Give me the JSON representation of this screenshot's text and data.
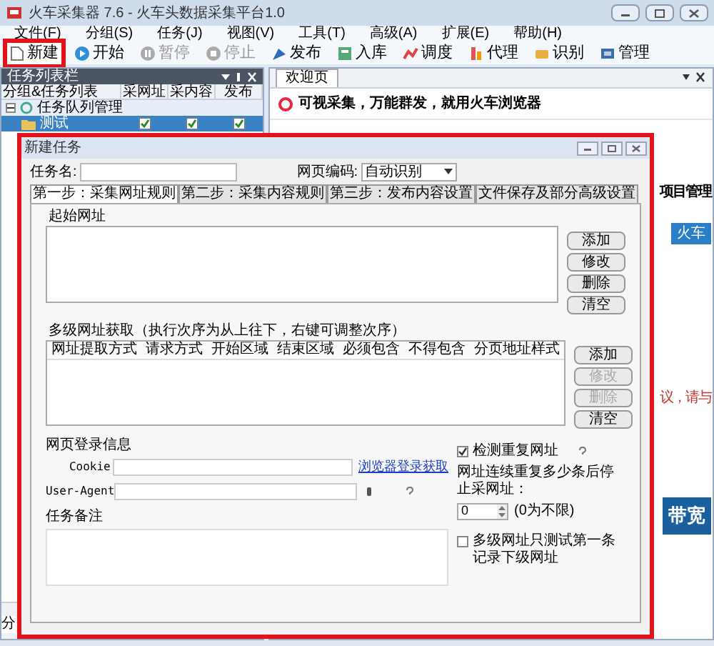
{
  "window": {
    "title": "火车采集器 7.6 - 火车头数据采集平台1.0"
  },
  "menu": [
    "文件(F)",
    "分组(S)",
    "任务(J)",
    "视图(V)",
    "工具(T)",
    "高级(A)",
    "扩展(E)",
    "帮助(H)"
  ],
  "toolbar": [
    {
      "label": "新建",
      "disabled": false,
      "highlighted": true
    },
    {
      "label": "开始",
      "disabled": false,
      "highlighted": false
    },
    {
      "label": "暂停",
      "disabled": true,
      "highlighted": false
    },
    {
      "label": "停止",
      "disabled": true,
      "highlighted": false
    },
    {
      "label": "发布",
      "disabled": false,
      "highlighted": false
    },
    {
      "label": "入库",
      "disabled": false,
      "highlighted": false
    },
    {
      "label": "调度",
      "disabled": false,
      "highlighted": false
    },
    {
      "label": "代理",
      "disabled": false,
      "highlighted": false
    },
    {
      "label": "识别",
      "disabled": false,
      "highlighted": false
    },
    {
      "label": "管理",
      "disabled": false,
      "highlighted": false
    }
  ],
  "task_panel": {
    "title": "任务列表栏",
    "columns": [
      "分组&任务列表",
      "采网址",
      "采内容",
      "发布"
    ],
    "groups": [
      {
        "label": "任务队列管理",
        "expanded": true,
        "children": [
          {
            "label": "测试",
            "selected": true,
            "collect_urls": true,
            "collect_content": true,
            "publish": true
          }
        ]
      }
    ],
    "bottom_tab": "分"
  },
  "welcome": {
    "tab": "欢迎页",
    "slogan": "可视采集，万能群发，就用火车浏览器",
    "snippets": [
      {
        "kind": "heading",
        "text": "项目管理"
      },
      {
        "kind": "badge",
        "text": "火车"
      },
      {
        "kind": "note",
        "text": "议，请与"
      },
      {
        "kind": "banner",
        "text": "带宽"
      }
    ]
  },
  "dialog": {
    "title": "新建任务",
    "task_name_label": "任务名:",
    "encoding": {
      "label": "网页编码:",
      "value": "自动识别"
    },
    "tabs": [
      {
        "label": "第一步：采集网址规则",
        "selected": true
      },
      {
        "label": "第二步：采集内容规则",
        "selected": false
      },
      {
        "label": "第三步：发布内容设置",
        "selected": false
      },
      {
        "label": "文件保存及部分高级设置",
        "selected": false
      }
    ],
    "start_urls": {
      "label": "起始网址",
      "buttons": [
        {
          "label": "添加",
          "disabled": false
        },
        {
          "label": "修改",
          "disabled": false
        },
        {
          "label": "删除",
          "disabled": false
        },
        {
          "label": "清空",
          "disabled": false
        }
      ]
    },
    "multilevel": {
      "label": "多级网址获取（执行次序为从上往下，右键可调整次序）",
      "columns": [
        "网址提取方式",
        "请求方式",
        "开始区域",
        "结束区域",
        "必须包含",
        "不得包含",
        "分页地址样式"
      ],
      "buttons": [
        {
          "label": "添加",
          "disabled": false
        },
        {
          "label": "修改",
          "disabled": true
        },
        {
          "label": "删除",
          "disabled": true
        },
        {
          "label": "清空",
          "disabled": false
        }
      ]
    },
    "login": {
      "label": "网页登录信息",
      "cookie_label": "Cookie",
      "browser_link": "浏览器登录获取",
      "user_agent_label": "User-Agent"
    },
    "check_duplicates": {
      "label": "检测重复网址",
      "checked": true
    },
    "repeat_limit": {
      "label": "网址连续重复多少条后停止采网址：",
      "value": "0",
      "hint": "(0为不限)"
    },
    "test_first_only": {
      "label": "多级网址只测试第一条记录下级网址",
      "checked": false
    },
    "notes": {
      "label": "任务备注"
    }
  }
}
